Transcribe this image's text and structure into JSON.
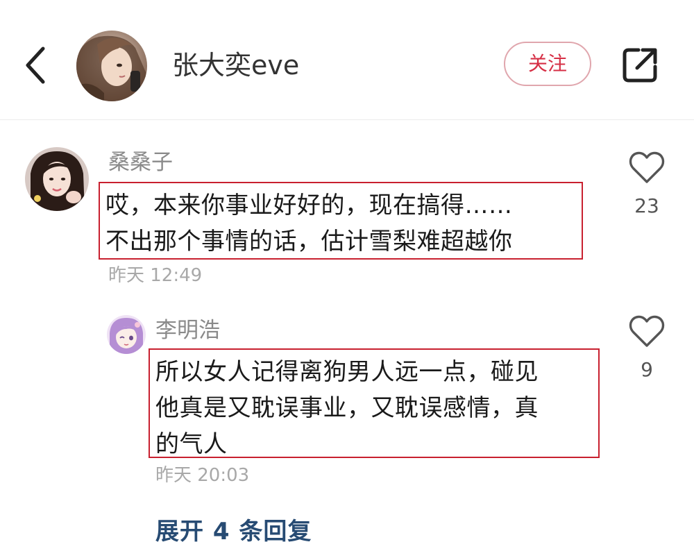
{
  "header": {
    "title": "张大奕eve",
    "follow_label": "关注"
  },
  "comments": [
    {
      "username": "桑桑子",
      "lines": [
        "哎，本来你事业好好的，现在搞得……",
        "不出那个事情的话，估计雪梨难超越你"
      ],
      "timestamp": "昨天 12:49",
      "likes": "23"
    },
    {
      "username": "李明浩",
      "lines": [
        "所以女人记得离狗男人远一点，碰见",
        "他真是又耽误事业，又耽误感情，真",
        "的气人"
      ],
      "timestamp": "昨天 20:03",
      "likes": "9"
    }
  ],
  "expand_replies_label": "展开 4 条回复",
  "colors": {
    "highlight_border": "#c8202f",
    "follow_text": "#d62f45",
    "expand_link": "#274b73"
  },
  "icons": {
    "back": "chevron-left-icon",
    "share": "share-icon",
    "like": "heart-outline-icon"
  }
}
